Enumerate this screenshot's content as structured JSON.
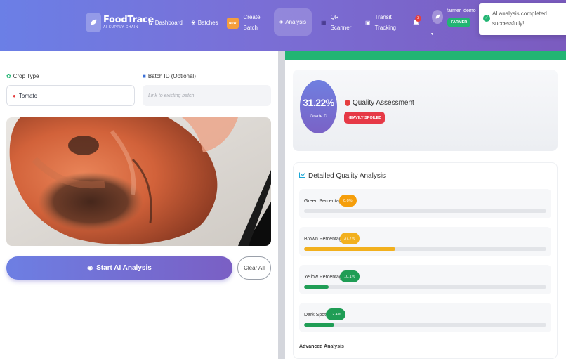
{
  "header": {
    "brand": "FoodTrace",
    "brand_sub": "AI SUPPLY CHAIN",
    "nav": {
      "dashboard": "Dashboard",
      "batches": "Batches",
      "new_badge": "NEW",
      "create_line1": "Create",
      "create_line2": "Batch",
      "analysis": "Analysis",
      "qr_line1": "QR",
      "qr_line2": "Scanner",
      "transit_line1": "Transit",
      "transit_line2": "Tracking"
    },
    "notification_count": "3",
    "username": "farmer_demo",
    "role": "FARMER"
  },
  "toast": {
    "message": "AI analysis completed successfully!"
  },
  "form": {
    "crop_label": "Crop Type",
    "crop_value": "Tomato",
    "batch_label": "Batch ID (Optional)",
    "batch_placeholder": "Link to existing batch",
    "start_button": "Start AI Analysis",
    "clear_button": "Clear All"
  },
  "result": {
    "score": "31.22%",
    "grade": "Grade D",
    "assessment_title": "Quality Assessment",
    "status": "HEAVILY SPOILED",
    "detail_title": "Detailed Quality Analysis",
    "metrics": [
      {
        "label": "Green Percentage",
        "value": "0.0%",
        "fraction": 0.0,
        "color": "#f59e0b"
      },
      {
        "label": "Brown Percentage",
        "value": "37.7%",
        "fraction": 0.377,
        "color": "#f2b01e"
      },
      {
        "label": "Yellow Percentage",
        "value": "10.1%",
        "fraction": 0.101,
        "color": "#1f9d55"
      },
      {
        "label": "Dark Spots",
        "value": "12.4%",
        "fraction": 0.124,
        "color": "#1f9d55"
      }
    ],
    "advanced_label": "Advanced Analysis"
  },
  "colors": {
    "header_start": "#6b7fe6",
    "header_end": "#7b5bbf",
    "success": "#22b573",
    "danger": "#e63946"
  }
}
